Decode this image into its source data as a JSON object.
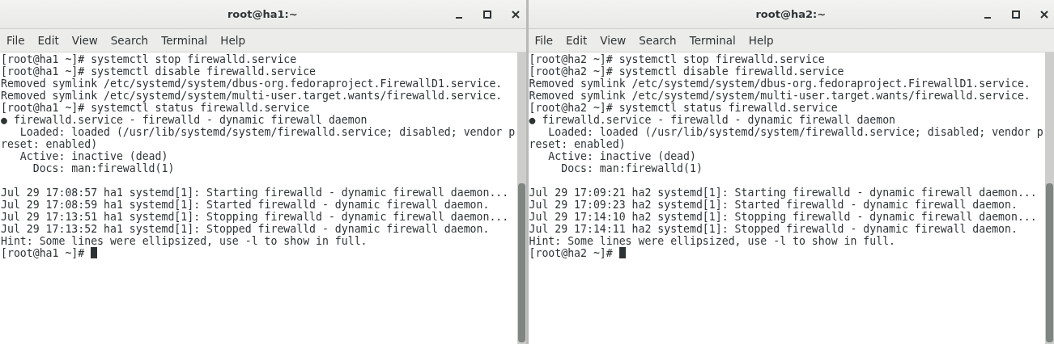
{
  "windows": [
    {
      "title": "root@ha1:~",
      "menu": [
        "File",
        "Edit",
        "View",
        "Search",
        "Terminal",
        "Help"
      ],
      "blocks": [
        [
          "[root@ha1 ~]# systemctl stop firewalld.service",
          "[root@ha1 ~]# systemctl disable firewalld.service",
          "Removed symlink /etc/systemd/system/dbus-org.fedoraproject.FirewallD1.service.",
          "Removed symlink /etc/systemd/system/multi-user.target.wants/firewalld.service.",
          "[root@ha1 ~]# systemctl status firewalld.service",
          "● firewalld.service - firewalld - dynamic firewall daemon",
          "   Loaded: loaded (/usr/lib/systemd/system/firewalld.service; disabled; vendor p",
          "reset: enabled)",
          "   Active: inactive (dead)",
          "     Docs: man:firewalld(1)"
        ],
        [
          "Jul 29 17:08:57 ha1 systemd[1]: Starting firewalld - dynamic firewall daemon...",
          "Jul 29 17:08:59 ha1 systemd[1]: Started firewalld - dynamic firewall daemon.",
          "Jul 29 17:13:51 ha1 systemd[1]: Stopping firewalld - dynamic firewall daemon...",
          "Jul 29 17:13:52 ha1 systemd[1]: Stopped firewalld - dynamic firewall daemon.",
          "Hint: Some lines were ellipsized, use -l to show in full.",
          "[root@ha1 ~]# "
        ]
      ]
    },
    {
      "title": "root@ha2:~",
      "menu": [
        "File",
        "Edit",
        "View",
        "Search",
        "Terminal",
        "Help"
      ],
      "blocks": [
        [
          "[root@ha2 ~]# systemctl stop firewalld.service",
          "[root@ha2 ~]# systemctl disable firewalld.service",
          "Removed symlink /etc/systemd/system/dbus-org.fedoraproject.FirewallD1.service.",
          "Removed symlink /etc/systemd/system/multi-user.target.wants/firewalld.service.",
          "[root@ha2 ~]# systemctl status firewalld.service",
          "● firewalld.service - firewalld - dynamic firewall daemon",
          "   Loaded: loaded (/usr/lib/systemd/system/firewalld.service; disabled; vendor p",
          "reset: enabled)",
          "   Active: inactive (dead)",
          "     Docs: man:firewalld(1)"
        ],
        [
          "Jul 29 17:09:21 ha2 systemd[1]: Starting firewalld - dynamic firewall daemon...",
          "Jul 29 17:09:23 ha2 systemd[1]: Started firewalld - dynamic firewall daemon.",
          "Jul 29 17:14:10 ha2 systemd[1]: Stopping firewalld - dynamic firewall daemon...",
          "Jul 29 17:14:11 ha2 systemd[1]: Stopped firewalld - dynamic firewall daemon.",
          "Hint: Some lines were ellipsized, use -l to show in full.",
          "[root@ha2 ~]# "
        ]
      ]
    }
  ]
}
